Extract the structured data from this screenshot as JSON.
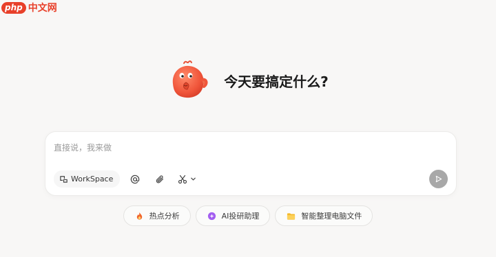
{
  "watermark": {
    "badge": "php",
    "text": "中文网"
  },
  "hero": {
    "title": "今天要搞定什么?"
  },
  "composer": {
    "placeholder": "直接说，我来做",
    "workspace_label": "WorkSpace"
  },
  "chips": [
    {
      "label": "热点分析",
      "icon": "fire-icon",
      "color": "#f0642b"
    },
    {
      "label": "AI投研助理",
      "icon": "ai-sparkle-icon",
      "color": "#a35ef0"
    },
    {
      "label": "智能整理电脑文件",
      "icon": "folder-icon",
      "color": "#f5b92b"
    }
  ],
  "colors": {
    "accent": "#e8402a",
    "background": "#f8f7f6",
    "send_button": "#a8a8a8"
  }
}
